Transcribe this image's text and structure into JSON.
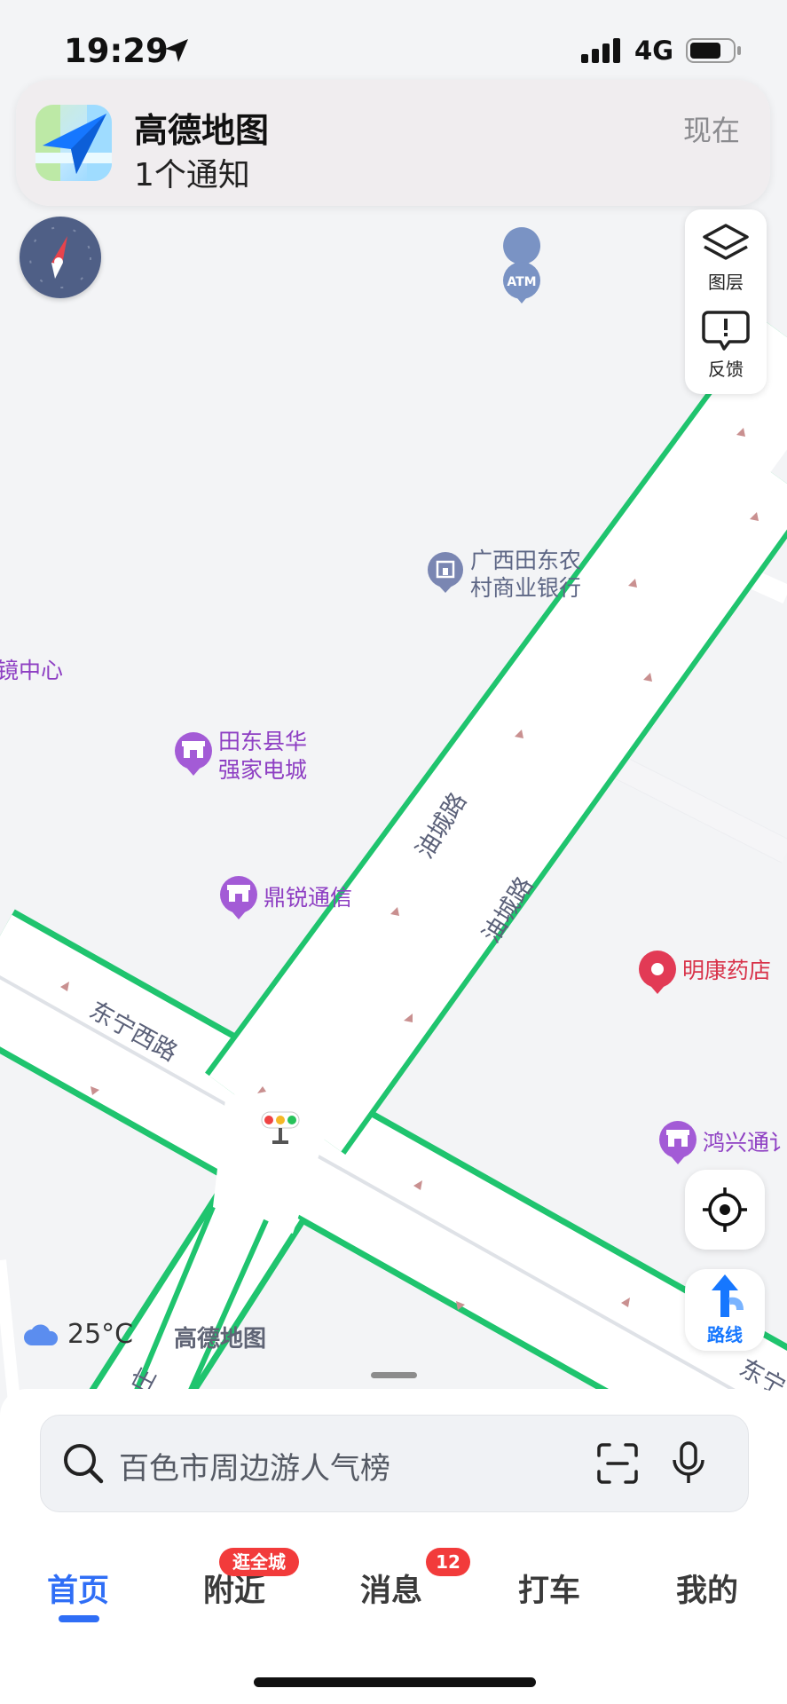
{
  "status_bar": {
    "time": "19:29",
    "network": "4G"
  },
  "notification": {
    "app_name": "高德地图",
    "message": "1个通知",
    "time": "现在"
  },
  "map_tools": {
    "layers_label": "图层",
    "feedback_label": "反馈",
    "route_label": "路线"
  },
  "map": {
    "pois": {
      "atm": "ATM",
      "bank_line1": "广西田东农",
      "bank_line2": "村商业银行",
      "optics": "镜中心",
      "electronics_line1": "田东县华",
      "electronics_line2": "强家电城",
      "telecom": "鼎锐通信",
      "pharmacy": "明康药店",
      "hongxing": "鸿兴通讠"
    },
    "roads": {
      "youcheng": "油城路",
      "dongning_west": "东宁西路",
      "bottom_left": "庄",
      "bottom_right": "东宁",
      "far_right": "东"
    }
  },
  "weather": {
    "temperature": "25°C"
  },
  "watermark": "高德地图",
  "search": {
    "placeholder": "百色市周边游人气榜"
  },
  "tabs": [
    {
      "label": "首页",
      "active": true
    },
    {
      "label": "附近",
      "badge": "逛全城"
    },
    {
      "label": "消息",
      "badge": "12"
    },
    {
      "label": "打车"
    },
    {
      "label": "我的"
    }
  ],
  "colors": {
    "accent": "#2f6ef6",
    "traffic_green": "#1fc46e",
    "badge_red": "#f23b3b",
    "poi_purple": "#a35bd6"
  }
}
